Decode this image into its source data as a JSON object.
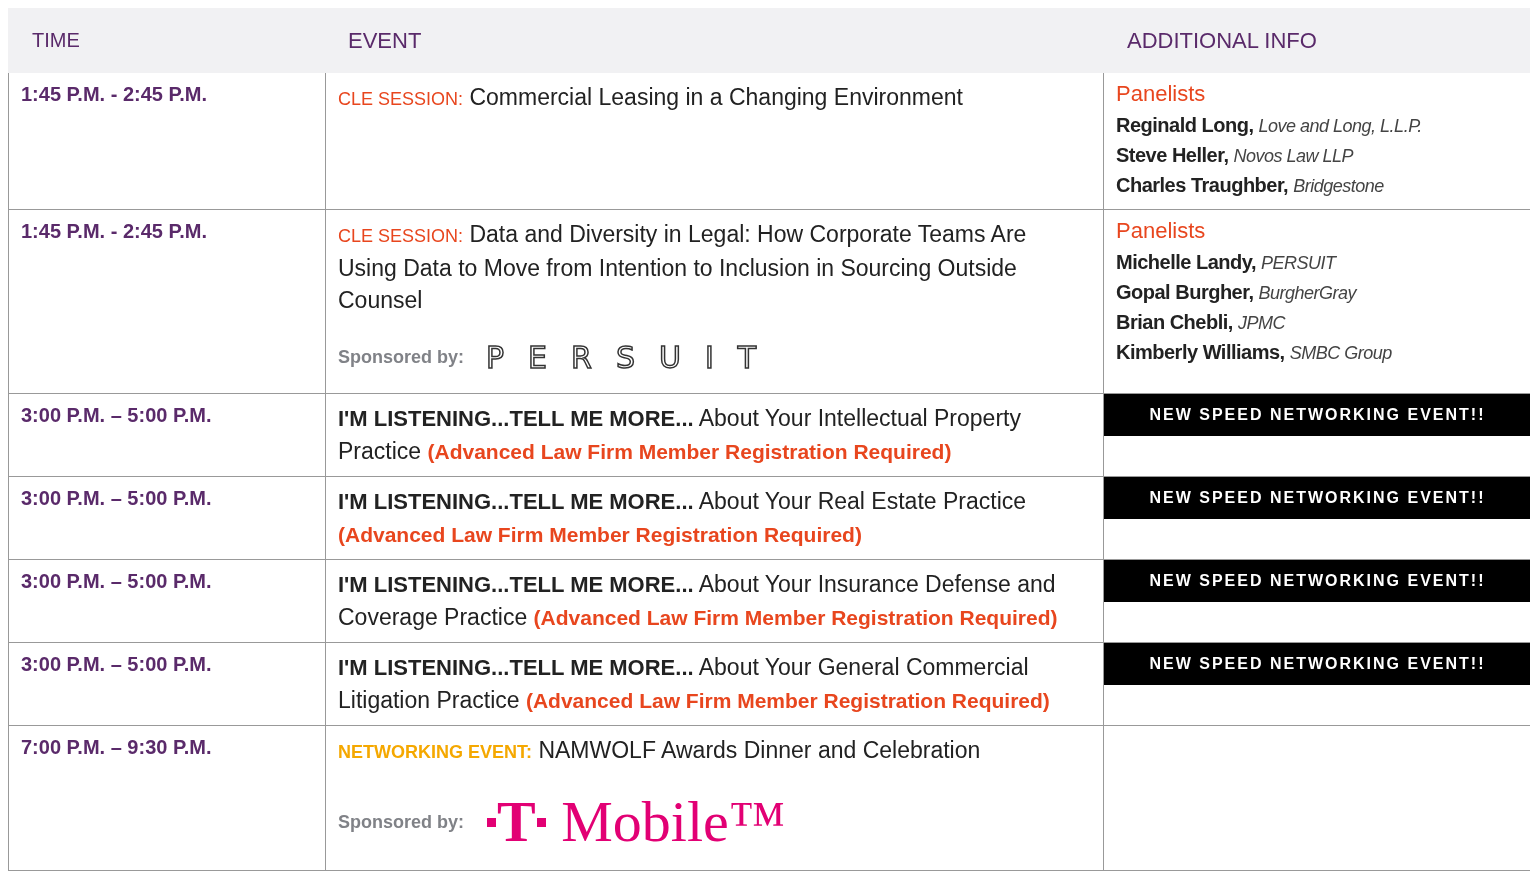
{
  "columns": [
    "TIME",
    "EVENT",
    "ADDITIONAL INFO"
  ],
  "rows": [
    {
      "time": "1:45 P.M. - 2:45 P.M.",
      "event": [
        {
          "kind": "label",
          "text": "CLE SESSION:"
        },
        {
          "kind": "text",
          "text": "Commercial Leasing in a Changing Environment"
        }
      ],
      "info": {
        "kind": "panel",
        "heading": "Panelists",
        "panelists": [
          {
            "name": "Reginald Long,",
            "affiliation": "Love and Long, L.L.P."
          },
          {
            "name": "Steve Heller,",
            "affiliation": "Novos Law LLP"
          },
          {
            "name": "Charles Traughber,",
            "affiliation": "Bridgestone"
          }
        ]
      }
    },
    {
      "time": "1:45 P.M. - 2:45 P.M.",
      "event": [
        {
          "kind": "label",
          "text": "CLE SESSION:"
        },
        {
          "kind": "text",
          "text": "Data and Diversity in Legal: How Corporate Teams Are Using Data to Move from Intention to Inclusion in Sourcing Outside Counsel"
        }
      ],
      "sponsor": {
        "label": "Sponsored by:",
        "kind": "outline",
        "logo": "PERSUIT"
      },
      "info": {
        "kind": "panel",
        "heading": "Panelists",
        "panelists": [
          {
            "name": "Michelle Landy,",
            "affiliation": "PERSUIT"
          },
          {
            "name": "Gopal Burgher,",
            "affiliation": "BurgherGray"
          },
          {
            "name": "Brian Chebli,",
            "affiliation": "JPMC"
          },
          {
            "name": "Kimberly Williams,",
            "affiliation": "SMBC Group"
          }
        ]
      }
    },
    {
      "time": "3:00 P.M. – 5:00 P.M.",
      "event": [
        {
          "kind": "lead",
          "text": "I'M LISTENING...TELL ME MORE..."
        },
        {
          "kind": "text",
          "text": "About Your Intellectual Property Practice"
        },
        {
          "kind": "note",
          "text": "(Advanced Law Firm Member Registration Required)"
        }
      ],
      "info": {
        "kind": "banner",
        "text": "NEW SPEED NETWORKING EVENT!!"
      }
    },
    {
      "time": "3:00 P.M. – 5:00 P.M.",
      "event": [
        {
          "kind": "lead",
          "text": "I'M LISTENING...TELL ME MORE..."
        },
        {
          "kind": "text",
          "text": "About Your Real Estate Practice"
        },
        {
          "kind": "note",
          "text": "(Advanced Law Firm Member Registration Required)"
        }
      ],
      "info": {
        "kind": "banner",
        "text": "NEW SPEED NETWORKING EVENT!!"
      }
    },
    {
      "time": "3:00 P.M. – 5:00 P.M.",
      "event": [
        {
          "kind": "lead",
          "text": "I'M LISTENING...TELL ME MORE..."
        },
        {
          "kind": "text",
          "text": "About Your Insurance Defense and Coverage Practice"
        },
        {
          "kind": "note",
          "text": "(Advanced Law Firm Member Registration Required)"
        }
      ],
      "info": {
        "kind": "banner",
        "text": "NEW SPEED NETWORKING EVENT!!"
      }
    },
    {
      "time": "3:00 P.M. – 5:00 P.M.",
      "event": [
        {
          "kind": "lead",
          "text": "I'M LISTENING...TELL ME MORE..."
        },
        {
          "kind": "text",
          "text": "About Your General Commercial Litigation Practice"
        },
        {
          "kind": "note",
          "text": "(Advanced Law Firm Member Registration Required)"
        }
      ],
      "info": {
        "kind": "banner",
        "text": "NEW SPEED NETWORKING EVENT!!"
      }
    },
    {
      "time": "7:00 P.M. – 9:30 P.M.",
      "event": [
        {
          "kind": "label_networking",
          "text": "NETWORKING EVENT:"
        },
        {
          "kind": "text",
          "text": "NAMWOLF Awards Dinner and Celebration"
        }
      ],
      "sponsor": {
        "label": "Sponsored by:",
        "kind": "brand",
        "logo_mark": "T",
        "logo": "Mobile™"
      }
    }
  ]
}
